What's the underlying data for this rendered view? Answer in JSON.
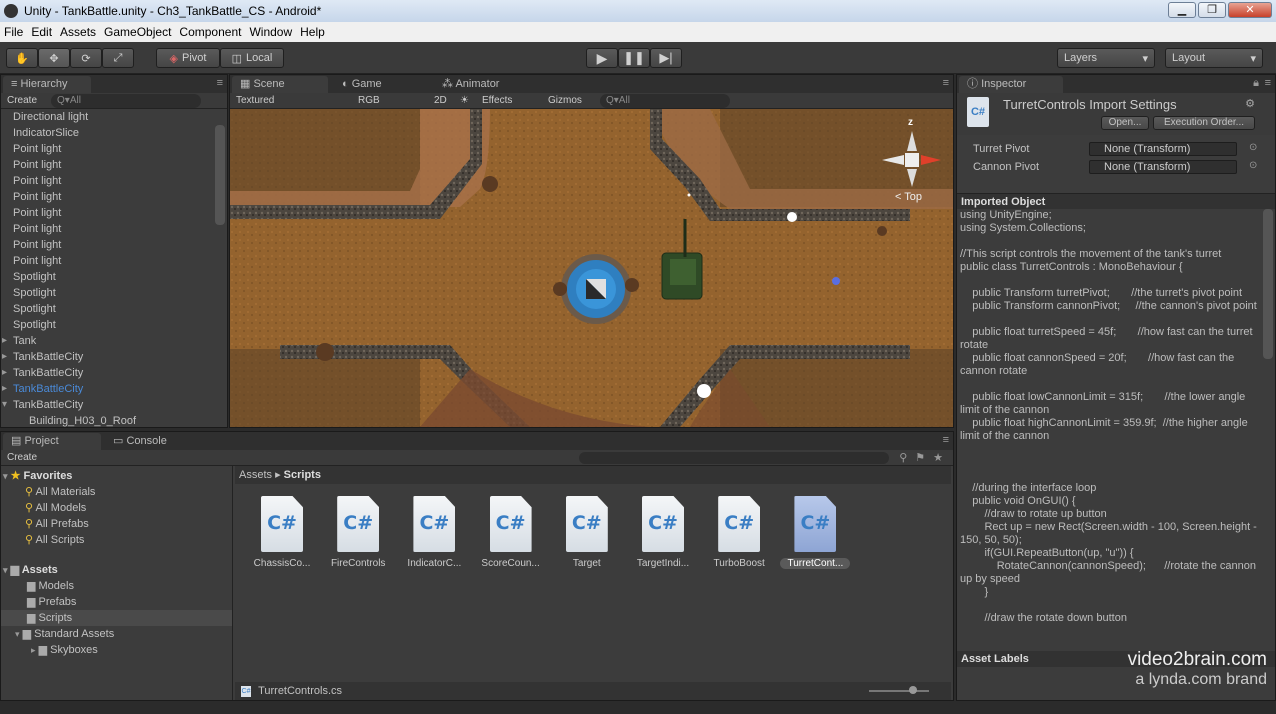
{
  "window": {
    "title": "Unity - TankBattle.unity - Ch3_TankBattle_CS - Android*",
    "buttons": [
      "▁",
      "❐",
      "✕"
    ]
  },
  "menu": [
    "File",
    "Edit",
    "Assets",
    "GameObject",
    "Component",
    "Window",
    "Help"
  ],
  "toolbar": {
    "pivot": "Pivot",
    "local": "Local",
    "layers": "Layers",
    "layout": "Layout"
  },
  "hierarchy": {
    "tab": "Hierarchy",
    "create": "Create",
    "search_placeholder": "Q▾All",
    "items": [
      "Directional light",
      "IndicatorSlice",
      "Point light",
      "Point light",
      "Point light",
      "Point light",
      "Point light",
      "Point light",
      "Point light",
      "Point light",
      "Spotlight",
      "Spotlight",
      "Spotlight",
      "Spotlight",
      "Tank",
      "TankBattleCity",
      "TankBattleCity",
      "TankBattleCity",
      "TankBattleCity",
      "Building_H03_0_Roof"
    ],
    "selected_index": 17
  },
  "scene": {
    "tabs": [
      "Scene",
      "Game",
      "Animator"
    ],
    "shading": "Textured",
    "render": "RGB",
    "mode2d": "2D",
    "effects": "Effects",
    "gizmos": "Gizmos",
    "search_placeholder": "Q▾All",
    "gizmo_label": "< Top",
    "gizmo_axis": "z"
  },
  "project": {
    "tabs": [
      "Project",
      "Console"
    ],
    "create": "Create",
    "favorites_label": "Favorites",
    "favorites": [
      "All Materials",
      "All Models",
      "All Prefabs",
      "All Scripts"
    ],
    "assets_label": "Assets",
    "folders": [
      "Models",
      "Prefabs",
      "Scripts",
      "Standard Assets",
      "Skyboxes"
    ],
    "breadcrumb_root": "Assets",
    "breadcrumb_sep": "▸",
    "breadcrumb_current": "Scripts",
    "files": [
      "ChassisCo...",
      "FireControls",
      "IndicatorC...",
      "ScoreCoun...",
      "Target",
      "TargetIndi...",
      "TurboBoost",
      "TurretCont..."
    ],
    "file_icon": "C#",
    "status_file": "TurretControls.cs"
  },
  "inspector": {
    "tab": "Inspector",
    "title": "TurretControls Import Settings",
    "open_button": "Open...",
    "exec_button": "Execution Order...",
    "fields": [
      {
        "label": "Turret Pivot",
        "value": "None (Transform)"
      },
      {
        "label": "Cannon Pivot",
        "value": "None (Transform)"
      }
    ],
    "imported_header": "Imported Object",
    "code": "using UnityEngine;\nusing System.Collections;\n\n//This script controls the movement of the tank's turret\npublic class TurretControls : MonoBehaviour {\n\n    public Transform turretPivot;       //the turret's pivot point\n    public Transform cannonPivot;     //the cannon's pivot point\n\n    public float turretSpeed = 45f;       //how fast can the turret rotate\n    public float cannonSpeed = 20f;       //how fast can the cannon rotate\n\n    public float lowCannonLimit = 315f;       //the lower angle limit of the cannon\n    public float highCannonLimit = 359.9f;  //the higher angle limit of the cannon\n\n\n\n    //during the interface loop\n    public void OnGUI() {\n        //draw to rotate up button\n        Rect up = new Rect(Screen.width - 100, Screen.height - 150, 50, 50);\n        if(GUI.RepeatButton(up, \"u\")) {\n            RotateCannon(cannonSpeed);      //rotate the cannon up by speed\n        }\n\n        //draw the rotate down button",
    "asset_labels": "Asset Labels"
  },
  "watermark": {
    "line1": "video2brain.com",
    "line2": "a lynda.com brand"
  }
}
